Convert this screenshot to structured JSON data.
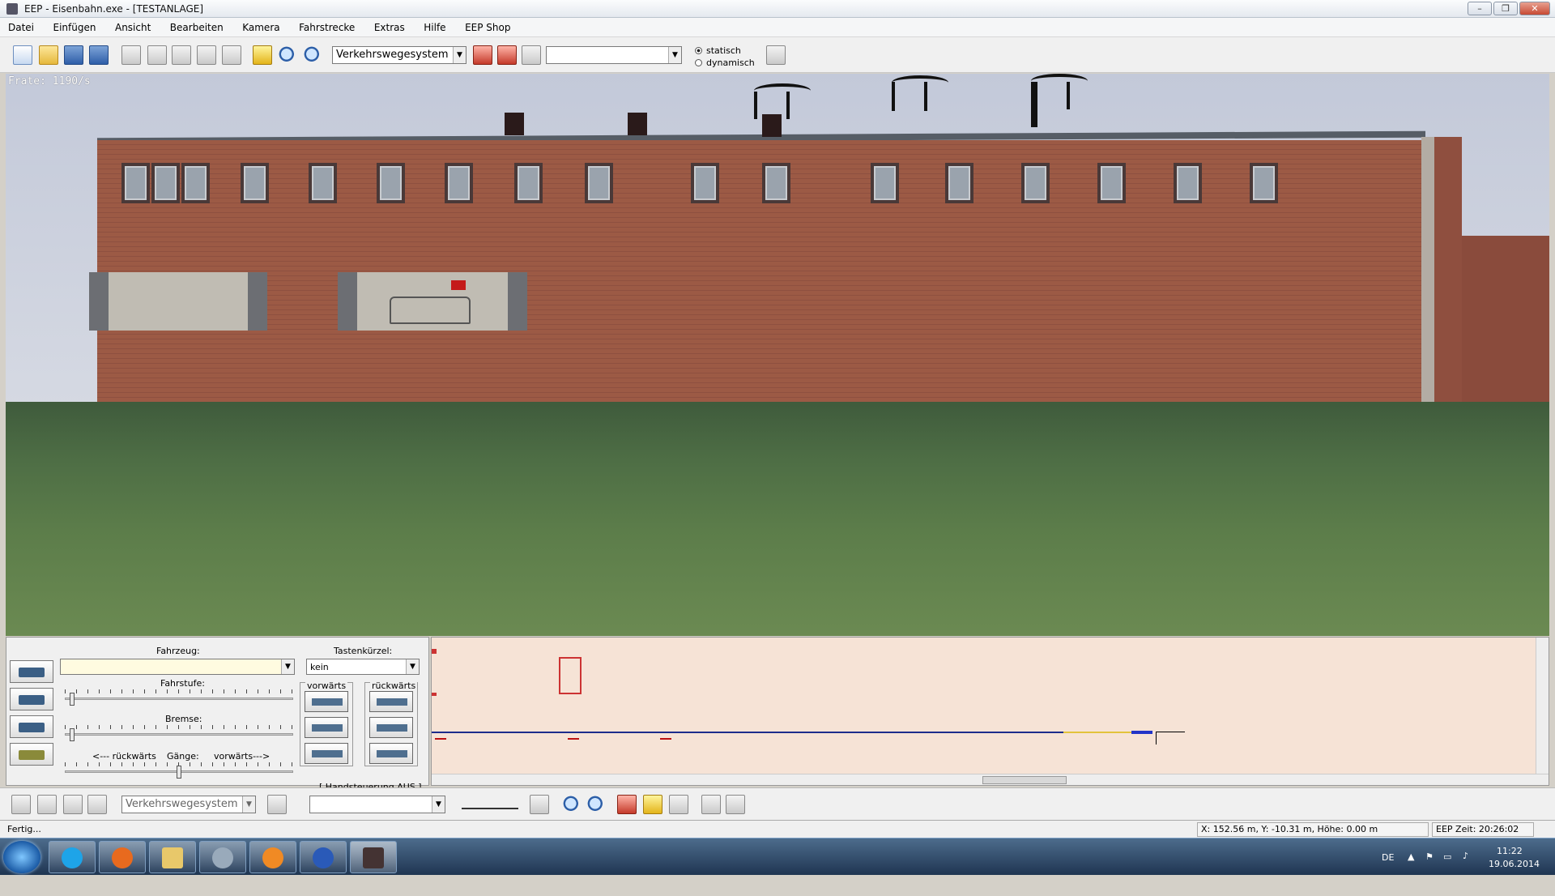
{
  "window": {
    "title": "EEP - Eisenbahn.exe - [TESTANLAGE]",
    "min": "–",
    "max": "❐",
    "close": "✕"
  },
  "menu": [
    "Datei",
    "Einfügen",
    "Ansicht",
    "Bearbeiten",
    "Kamera",
    "Fahrstrecke",
    "Extras",
    "Hilfe",
    "EEP Shop"
  ],
  "toolbar": {
    "system_select": "Verkehrswegesystem",
    "object_select": "",
    "mode_static": "statisch",
    "mode_dynamic": "dynamisch",
    "mode_selected": "statisch"
  },
  "viewport": {
    "fps": "Frate: 1190/s"
  },
  "control": {
    "vehicle_label": "Fahrzeug:",
    "vehicle_value": "",
    "shortcut_label": "Tastenkürzel:",
    "shortcut_value": "kein",
    "speed_label": "Fahrstufe:",
    "brake_label": "Bremse:",
    "gears_back": "<--- rückwärts",
    "gears_label": "Gänge:",
    "gears_fwd": "vorwärts--->",
    "forward_label": "vorwärts",
    "backward_label": "rückwärts",
    "manual_state": "[ Handsteuerung AUS ]",
    "speed_level": 0.02,
    "brake_level": 0.02,
    "gear_level": 0.5
  },
  "bottom_toolbar": {
    "system_select": "Verkehrswegesystem",
    "object_select": ""
  },
  "status": {
    "text": "Fertig...",
    "coords": "X: 152.56 m, Y: -10.31 m, Höhe: 0.00 m",
    "eep_time": "EEP Zeit: 20:26:02"
  },
  "taskbar": {
    "lang": "DE",
    "time": "11:22",
    "date": "19.06.2014",
    "apps": [
      "skype-icon",
      "firefox-icon",
      "explorer-icon",
      "network-icon",
      "blender-icon",
      "globe-icon",
      "eep-icon"
    ]
  },
  "colors": {
    "brick": "#9c5a45",
    "ground": "#4e6e45",
    "sky": "#c9cedd",
    "track_bg": "#f6e3d6",
    "track_line": "#1c2c8c"
  }
}
